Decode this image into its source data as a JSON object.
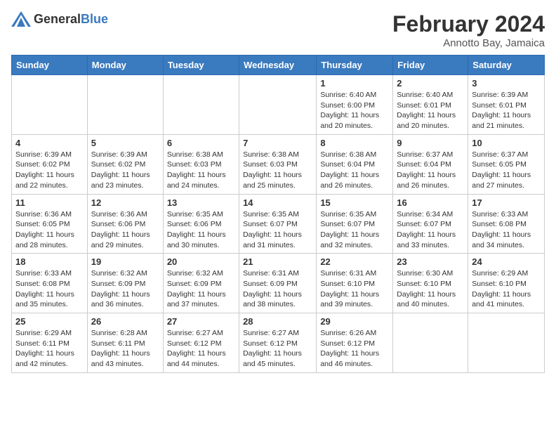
{
  "header": {
    "logo_general": "General",
    "logo_blue": "Blue",
    "month_title": "February 2024",
    "location": "Annotto Bay, Jamaica"
  },
  "weekdays": [
    "Sunday",
    "Monday",
    "Tuesday",
    "Wednesday",
    "Thursday",
    "Friday",
    "Saturday"
  ],
  "weeks": [
    [
      {
        "day": "",
        "info": ""
      },
      {
        "day": "",
        "info": ""
      },
      {
        "day": "",
        "info": ""
      },
      {
        "day": "",
        "info": ""
      },
      {
        "day": "1",
        "info": "Sunrise: 6:40 AM\nSunset: 6:00 PM\nDaylight: 11 hours and 20 minutes."
      },
      {
        "day": "2",
        "info": "Sunrise: 6:40 AM\nSunset: 6:01 PM\nDaylight: 11 hours and 20 minutes."
      },
      {
        "day": "3",
        "info": "Sunrise: 6:39 AM\nSunset: 6:01 PM\nDaylight: 11 hours and 21 minutes."
      }
    ],
    [
      {
        "day": "4",
        "info": "Sunrise: 6:39 AM\nSunset: 6:02 PM\nDaylight: 11 hours and 22 minutes."
      },
      {
        "day": "5",
        "info": "Sunrise: 6:39 AM\nSunset: 6:02 PM\nDaylight: 11 hours and 23 minutes."
      },
      {
        "day": "6",
        "info": "Sunrise: 6:38 AM\nSunset: 6:03 PM\nDaylight: 11 hours and 24 minutes."
      },
      {
        "day": "7",
        "info": "Sunrise: 6:38 AM\nSunset: 6:03 PM\nDaylight: 11 hours and 25 minutes."
      },
      {
        "day": "8",
        "info": "Sunrise: 6:38 AM\nSunset: 6:04 PM\nDaylight: 11 hours and 26 minutes."
      },
      {
        "day": "9",
        "info": "Sunrise: 6:37 AM\nSunset: 6:04 PM\nDaylight: 11 hours and 26 minutes."
      },
      {
        "day": "10",
        "info": "Sunrise: 6:37 AM\nSunset: 6:05 PM\nDaylight: 11 hours and 27 minutes."
      }
    ],
    [
      {
        "day": "11",
        "info": "Sunrise: 6:36 AM\nSunset: 6:05 PM\nDaylight: 11 hours and 28 minutes."
      },
      {
        "day": "12",
        "info": "Sunrise: 6:36 AM\nSunset: 6:06 PM\nDaylight: 11 hours and 29 minutes."
      },
      {
        "day": "13",
        "info": "Sunrise: 6:35 AM\nSunset: 6:06 PM\nDaylight: 11 hours and 30 minutes."
      },
      {
        "day": "14",
        "info": "Sunrise: 6:35 AM\nSunset: 6:07 PM\nDaylight: 11 hours and 31 minutes."
      },
      {
        "day": "15",
        "info": "Sunrise: 6:35 AM\nSunset: 6:07 PM\nDaylight: 11 hours and 32 minutes."
      },
      {
        "day": "16",
        "info": "Sunrise: 6:34 AM\nSunset: 6:07 PM\nDaylight: 11 hours and 33 minutes."
      },
      {
        "day": "17",
        "info": "Sunrise: 6:33 AM\nSunset: 6:08 PM\nDaylight: 11 hours and 34 minutes."
      }
    ],
    [
      {
        "day": "18",
        "info": "Sunrise: 6:33 AM\nSunset: 6:08 PM\nDaylight: 11 hours and 35 minutes."
      },
      {
        "day": "19",
        "info": "Sunrise: 6:32 AM\nSunset: 6:09 PM\nDaylight: 11 hours and 36 minutes."
      },
      {
        "day": "20",
        "info": "Sunrise: 6:32 AM\nSunset: 6:09 PM\nDaylight: 11 hours and 37 minutes."
      },
      {
        "day": "21",
        "info": "Sunrise: 6:31 AM\nSunset: 6:09 PM\nDaylight: 11 hours and 38 minutes."
      },
      {
        "day": "22",
        "info": "Sunrise: 6:31 AM\nSunset: 6:10 PM\nDaylight: 11 hours and 39 minutes."
      },
      {
        "day": "23",
        "info": "Sunrise: 6:30 AM\nSunset: 6:10 PM\nDaylight: 11 hours and 40 minutes."
      },
      {
        "day": "24",
        "info": "Sunrise: 6:29 AM\nSunset: 6:10 PM\nDaylight: 11 hours and 41 minutes."
      }
    ],
    [
      {
        "day": "25",
        "info": "Sunrise: 6:29 AM\nSunset: 6:11 PM\nDaylight: 11 hours and 42 minutes."
      },
      {
        "day": "26",
        "info": "Sunrise: 6:28 AM\nSunset: 6:11 PM\nDaylight: 11 hours and 43 minutes."
      },
      {
        "day": "27",
        "info": "Sunrise: 6:27 AM\nSunset: 6:12 PM\nDaylight: 11 hours and 44 minutes."
      },
      {
        "day": "28",
        "info": "Sunrise: 6:27 AM\nSunset: 6:12 PM\nDaylight: 11 hours and 45 minutes."
      },
      {
        "day": "29",
        "info": "Sunrise: 6:26 AM\nSunset: 6:12 PM\nDaylight: 11 hours and 46 minutes."
      },
      {
        "day": "",
        "info": ""
      },
      {
        "day": "",
        "info": ""
      }
    ]
  ]
}
